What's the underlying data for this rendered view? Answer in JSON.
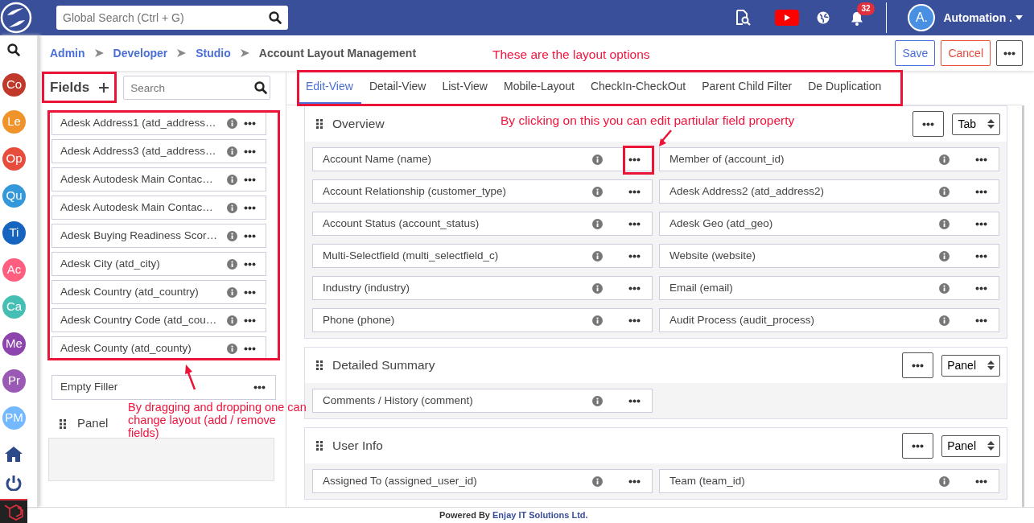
{
  "topbar": {
    "search_placeholder": "Global Search (Ctrl + G)",
    "notification_count": "32",
    "avatar_initials": "A.",
    "user_name": "Automation ."
  },
  "sidebar": {
    "modules": [
      {
        "label": "Co",
        "color": "#c0392b"
      },
      {
        "label": "Le",
        "color": "#f0932b"
      },
      {
        "label": "Op",
        "color": "#e74c3c"
      },
      {
        "label": "Qu",
        "color": "#3498db"
      },
      {
        "label": "Ti",
        "color": "#1565c0"
      },
      {
        "label": "Ac",
        "color": "#ff5e7e"
      },
      {
        "label": "Ca",
        "color": "#45bfb4"
      },
      {
        "label": "Me",
        "color": "#8e44ad"
      },
      {
        "label": "Pr",
        "color": "#9b59b6"
      },
      {
        "label": "PM",
        "color": "#74b9ff"
      }
    ]
  },
  "breadcrumb": [
    {
      "label": "Admin",
      "link": true
    },
    {
      "label": "Developer",
      "link": true
    },
    {
      "label": "Studio",
      "link": true
    },
    {
      "label": "Account Layout Management",
      "link": false
    }
  ],
  "actions": {
    "save": "Save",
    "cancel": "Cancel"
  },
  "fields_panel": {
    "title": "Fields",
    "search_placeholder": "Search",
    "fields": [
      "Adesk Address1 (atd_address…",
      "Adesk Address3 (atd_address…",
      "Adesk Autodesk Main Contac…",
      "Adesk Autodesk Main Contac…",
      "Adesk Buying Readiness Scor…",
      "Adesk City (atd_city)",
      "Adesk Country (atd_country)",
      "Adesk Country Code (atd_cou…",
      "Adesk County (atd_county)"
    ],
    "filler": "Empty Filler",
    "panel_label": "Panel"
  },
  "tabs": [
    {
      "label": "Edit-View",
      "selected": true
    },
    {
      "label": "Detail-View",
      "selected": false
    },
    {
      "label": "List-View",
      "selected": false
    },
    {
      "label": "Mobile-Layout",
      "selected": false
    },
    {
      "label": "CheckIn-CheckOut",
      "selected": false
    },
    {
      "label": "Parent Child Filter",
      "selected": false
    },
    {
      "label": "De Duplication",
      "selected": false
    }
  ],
  "sections": [
    {
      "title": "Overview",
      "layout_type": "Tab",
      "fields": [
        "Account Name (name)",
        "Member of (account_id)",
        "Account Relationship (customer_type)",
        "Adesk Address2 (atd_address2)",
        "Account Status (account_status)",
        "Adesk Geo (atd_geo)",
        "Multi-Selectfield (multi_selectfield_c)",
        "Website (website)",
        "Industry (industry)",
        "Email (email)",
        "Phone (phone)",
        "Audit Process (audit_process)"
      ]
    },
    {
      "title": "Detailed Summary",
      "layout_type": "Panel",
      "fields": [
        "Comments / History (comment)"
      ]
    },
    {
      "title": "User Info",
      "layout_type": "Panel",
      "fields": [
        "Assigned To (assigned_user_id)",
        "Team (team_id)"
      ]
    }
  ],
  "annotations": [
    "These are the layout options",
    "By clicking on this you can edit partiular field property",
    "By dragging and dropping one can change layout (add / remove fields)"
  ],
  "footer": {
    "prefix": "Powered By",
    "company": "Enjay IT Solutions Ltd."
  }
}
